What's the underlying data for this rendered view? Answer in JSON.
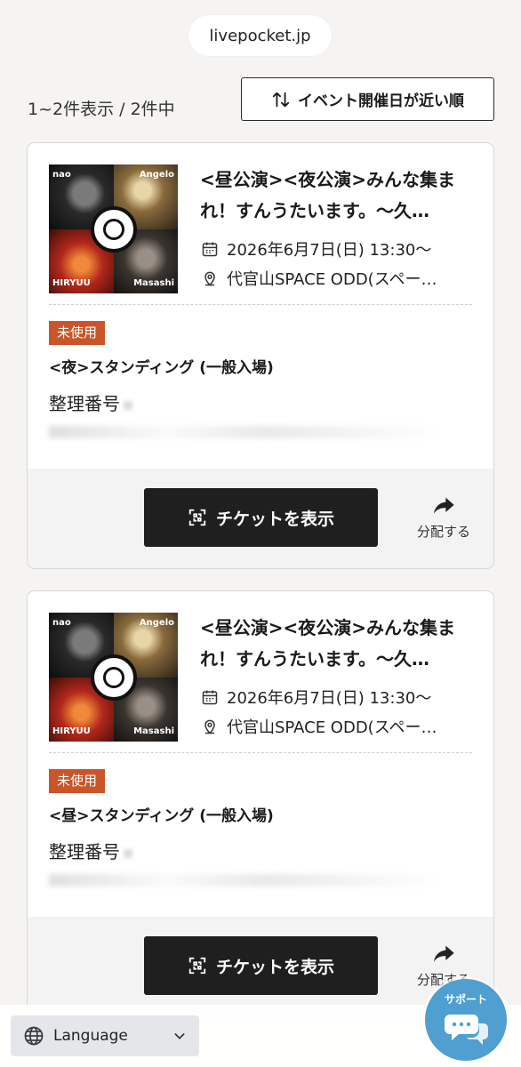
{
  "browser": {
    "url": "livepocket.jp"
  },
  "list": {
    "count_text": "1~2件表示 / 2件中",
    "sort_label": "イベント開催日が近い順"
  },
  "tickets": [
    {
      "title": "<昼公演><夜公演>みんな集まれ！すんうたいます。〜久…",
      "date": "2026年6月7日(日) 13:30〜",
      "venue": "代官山SPACE ODD(スペー…",
      "status": "未使用",
      "seat_type": "<夜>スタンディング (一般入場)",
      "number_label": "整理番号",
      "show_label": "チケットを表示",
      "share_label": "分配する",
      "thumb_names": [
        "nao",
        "Angelo",
        "HIRYUU",
        "Masashi"
      ]
    },
    {
      "title": "<昼公演><夜公演>みんな集まれ！すんうたいます。〜久…",
      "date": "2026年6月7日(日) 13:30〜",
      "venue": "代官山SPACE ODD(スペー…",
      "status": "未使用",
      "seat_type": "<昼>スタンディング (一般入場)",
      "number_label": "整理番号",
      "show_label": "チケットを表示",
      "share_label": "分配する",
      "thumb_names": [
        "nao",
        "Angelo",
        "HIRYUU",
        "Masashi"
      ]
    }
  ],
  "footer": {
    "language_label": "Language",
    "support_label": "サポート"
  },
  "colors": {
    "badge": "#c9562a",
    "primary_button": "#1f1f1f",
    "support": "#4f9fd1"
  }
}
